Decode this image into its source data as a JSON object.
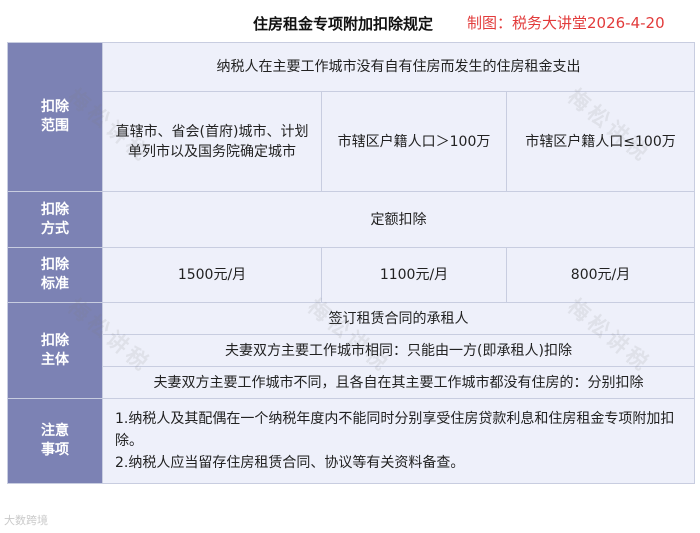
{
  "header": {
    "title": "住房租金专项附加扣除规定",
    "credit": "制图：税务大讲堂2026-4-20"
  },
  "rows": {
    "scope": {
      "label_1": "扣除",
      "label_2": "范围",
      "top": "纳税人在主要工作城市没有自有住房而发生的住房租金支出",
      "col1_line1": "直辖市、省会(首府)城市、计划",
      "col1_line2": "单列市以及国务院确定城市",
      "col2": "市辖区户籍人口＞100万",
      "col3": "市辖区户籍人口≤100万"
    },
    "method": {
      "label_1": "扣除",
      "label_2": "方式",
      "value": "定额扣除"
    },
    "standard": {
      "label_1": "扣除",
      "label_2": "标准",
      "col1": "1500元/月",
      "col2": "1100元/月",
      "col3": "800元/月"
    },
    "subject": {
      "label_1": "扣除",
      "label_2": "主体",
      "line1": "签订租赁合同的承租人",
      "line2": "夫妻双方主要工作城市相同：只能由一方(即承租人)扣除",
      "line3": "夫妻双方主要工作城市不同，且各自在其主要工作城市都没有住房的：分别扣除"
    },
    "notes": {
      "label_1": "注意",
      "label_2": "事项",
      "note1": "1.纳税人及其配偶在一个纳税年度内不能同时分别享受住房贷款利息和住房租金专项附加扣除。",
      "note2": "2.纳税人应当留存住房租赁合同、协议等有关资料备查。"
    }
  },
  "watermarks": {
    "text": "梅松讲税",
    "footer": "大数跨境"
  }
}
